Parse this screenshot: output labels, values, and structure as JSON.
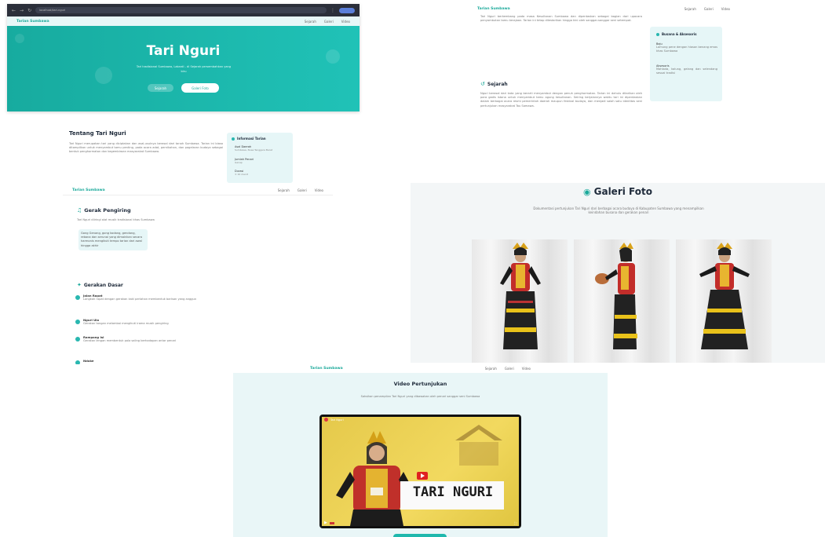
{
  "browser": {
    "url": "localhost/tari-nguri"
  },
  "nav": {
    "brand": "Tarian Sumbawa",
    "links": [
      "Sejarah",
      "Galeri",
      "Video"
    ]
  },
  "hero": {
    "title": "Tari Nguri",
    "subtitle": "Tari tradisional Sumbawa, Lakardi - di Sejarah persembahkan yang",
    "subtitle2": "biru",
    "btn_primary": "Sejarah",
    "btn_secondary": "Galeri Foto"
  },
  "about": {
    "title": "Tentang Tari Nguri",
    "paragraph": "Tari Nguri merupakan tari yang diciptakan dan asal-usulnya berasal dari tanah Sumbawa. Tarian ini biasa ditampilkan untuk menyambut tamu penting, pada acara adat, pernikahan, dan pagelaran budaya sebagai bentuk penghormatan dan kegembiraan masyarakat Sumbawa.",
    "info_title": "Informasi Tarian",
    "info_items": [
      {
        "label": "Asal Daerah",
        "value": "Sumbawa, Nusa Tenggara Barat"
      },
      {
        "label": "Jumlah Penari",
        "value": "Genap"
      },
      {
        "label": "Durasi",
        "value": "± 10 menit"
      }
    ]
  },
  "gerak": {
    "title": "Gerak Pengiring",
    "desc": "Tari Nguri diiringi alat musik tradisional khas Sumbawa",
    "list": "Gong Genang, gong kodang, gendang, rebana dan serunai yang dimainkan secara harmonis mengikuti tempo tarian dari awal hingga akhir",
    "gerakan_title": "Gerakan Dasar",
    "gerakan": [
      {
        "name": "Jalan Rapat",
        "desc": "Langkah rapat dengan gerakan kaki perlahan membentuk barisan yang anggun"
      },
      {
        "name": "Nguri Ulo",
        "desc": "Gerakan tangan melambai mengikuti irama musik pengiring"
      },
      {
        "name": "Rampang Isi",
        "desc": "Gerakan lengan membentuk pola saling berhadapan antar penari"
      },
      {
        "name": "Ndake",
        "desc": ""
      }
    ]
  },
  "sejarah": {
    "intro": "Tari Nguri berkembang pada masa Kesultanan Sumbawa dan dipentaskan sebagai bagian dari upacara penyambutan tamu kerajaan. Tarian ini tetap dilestarikan hingga kini oleh sanggar-sanggar seni setempat.",
    "title": "Sejarah",
    "paragraph": "Nguri berasal dari kata yang berarti menyambut dengan penuh penghormatan. Tarian ini dahulu ditarikan oleh para gadis istana untuk menyambut tamu agung kesultanan. Seiring berjalannya waktu tari ini dipentaskan dalam berbagai acara resmi pemerintah daerah maupun festival budaya, dan menjadi salah satu identitas seni pertunjukan masyarakat Tau Samawa.",
    "card_title": "Busana & Aksesoris",
    "card_items": [
      {
        "label": "Baju",
        "value": "Lamung pene dengan hiasan benang emas khas Sumbawa"
      },
      {
        "label": "Aksesoris",
        "value": "Mahkota, kalung, gelang dan selendang sesuai tradisi"
      }
    ]
  },
  "galeri": {
    "title": "Galeri Foto",
    "desc": "Dokumentasi pertunjukan Tari Nguri dari berbagai acara budaya di Kabupaten Sumbawa yang menampilkan keindahan busana dan gerakan penari"
  },
  "video": {
    "title": "Video Pertunjukan",
    "desc": "Saksikan penampilan Tari Nguri yang dibawakan oleh penari sanggar seni Sumbawa",
    "overlay_text": "TARI NGURI",
    "channel": "Tari Nguri"
  },
  "colors": {
    "accent": "#1aa99a",
    "hero": "#19b5ac",
    "card": "#e6f6f7"
  }
}
